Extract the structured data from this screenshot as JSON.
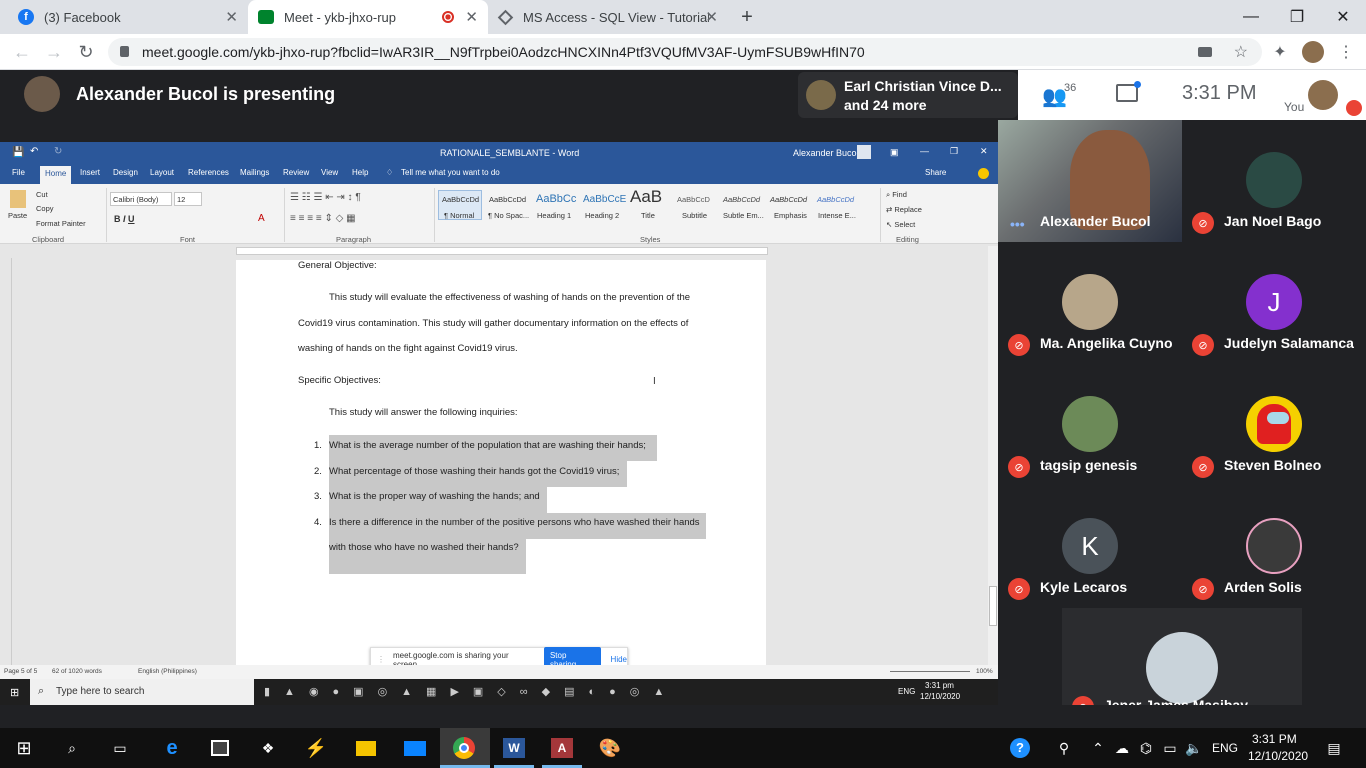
{
  "browser": {
    "tabs": [
      {
        "label": "(3) Facebook"
      },
      {
        "label": "Meet - ykb-jhxo-rup"
      },
      {
        "label": "MS Access - SQL View - Tutorials"
      }
    ],
    "url": "meet.google.com/ykb-jhxo-rup?fbclid=IwAR3IR__N9fTrpbei0AodzcHNCXINn4Ptf3VQUfMV3AF-UymFSUB9wHfIN70"
  },
  "meet": {
    "presenting": "Alexander Bucol is presenting",
    "others_line1": "Earl Christian Vince D...",
    "others_line2": "and 24 more",
    "participant_count": "36",
    "time": "3:31  PM",
    "you_label": "You",
    "participants": [
      {
        "name": "Alexander Bucol"
      },
      {
        "name": "Jan Noel Bago"
      },
      {
        "name": "Ma. Angelika Cuyno"
      },
      {
        "name": "Judelyn Salamanca",
        "initial": "J"
      },
      {
        "name": "tagsip genesis"
      },
      {
        "name": "Steven Bolneo"
      },
      {
        "name": "Kyle Lecaros",
        "initial": "K"
      },
      {
        "name": "Arden Solis"
      },
      {
        "name": "Jener James Masibay"
      }
    ]
  },
  "word": {
    "doc_title": "RATIONALE_SEMBLANTE  -  Word",
    "user": "Alexander Bucol",
    "tabs": [
      "File",
      "Home",
      "Insert",
      "Design",
      "Layout",
      "References",
      "Mailings",
      "Review",
      "View",
      "Help"
    ],
    "tell_me": "Tell me what you want to do",
    "share": "Share",
    "clipboard": {
      "paste": "Paste",
      "cut": "Cut",
      "copy": "Copy",
      "format_painter": "Format Painter",
      "group": "Clipboard"
    },
    "font": {
      "name": "Calibri (Body)",
      "size": "12",
      "group": "Font"
    },
    "paragraph_group": "Paragraph",
    "styles": [
      {
        "preview": "AaBbCcDd",
        "label": "¶ Normal"
      },
      {
        "preview": "AaBbCcDd",
        "label": "¶ No Spac..."
      },
      {
        "preview": "AaBbCc",
        "label": "Heading 1"
      },
      {
        "preview": "AaBbCcE",
        "label": "Heading 2"
      },
      {
        "preview": "AaB",
        "label": "Title"
      },
      {
        "preview": "AaBbCcD",
        "label": "Subtitle"
      },
      {
        "preview": "AaBbCcDd",
        "label": "Subtle Em..."
      },
      {
        "preview": "AaBbCcDd",
        "label": "Emphasis"
      },
      {
        "preview": "AaBbCcDd",
        "label": "Intense E..."
      }
    ],
    "styles_group": "Styles",
    "editing": {
      "find": "Find",
      "replace": "Replace",
      "select": "Select",
      "group": "Editing"
    },
    "document": {
      "general_heading": "General Objective:",
      "general_lines": [
        "This study will evaluate the effectiveness of washing of hands on the prevention of the",
        "Covid19 virus contamination.  This study will gather documentary information on the effects of",
        "washing of hands on the fight against Covid19 virus."
      ],
      "specific_heading": "Specific Objectives:",
      "intro": "This study will answer the following inquiries:",
      "items": [
        {
          "num": "1.",
          "text": "What is the average number of the population that are washing their hands;"
        },
        {
          "num": "2.",
          "text": "What percentage of those washing their hands got the Covid19 virus;"
        },
        {
          "num": "3.",
          "text": "What is the proper way of washing the hands; and"
        },
        {
          "num": "4.",
          "text": "Is there a difference in the number of the positive persons who have washed their hands"
        }
      ],
      "item4_cont": "with those who have no washed their hands?"
    },
    "status": {
      "page": "Page 5 of 5",
      "words": "62 of 1020 words",
      "lang": "English (Philippines)",
      "zoom": "100%"
    },
    "share_notice": "meet.google.com is sharing your screen.",
    "stop_sharing": "Stop sharing",
    "hide": "Hide",
    "inner_search": "Type here to search",
    "inner_time": "3:31 pm",
    "inner_date": "12/10/2020",
    "inner_lang": "ENG"
  },
  "taskbar": {
    "lang": "ENG",
    "time": "3:31 PM",
    "date": "12/10/2020"
  }
}
